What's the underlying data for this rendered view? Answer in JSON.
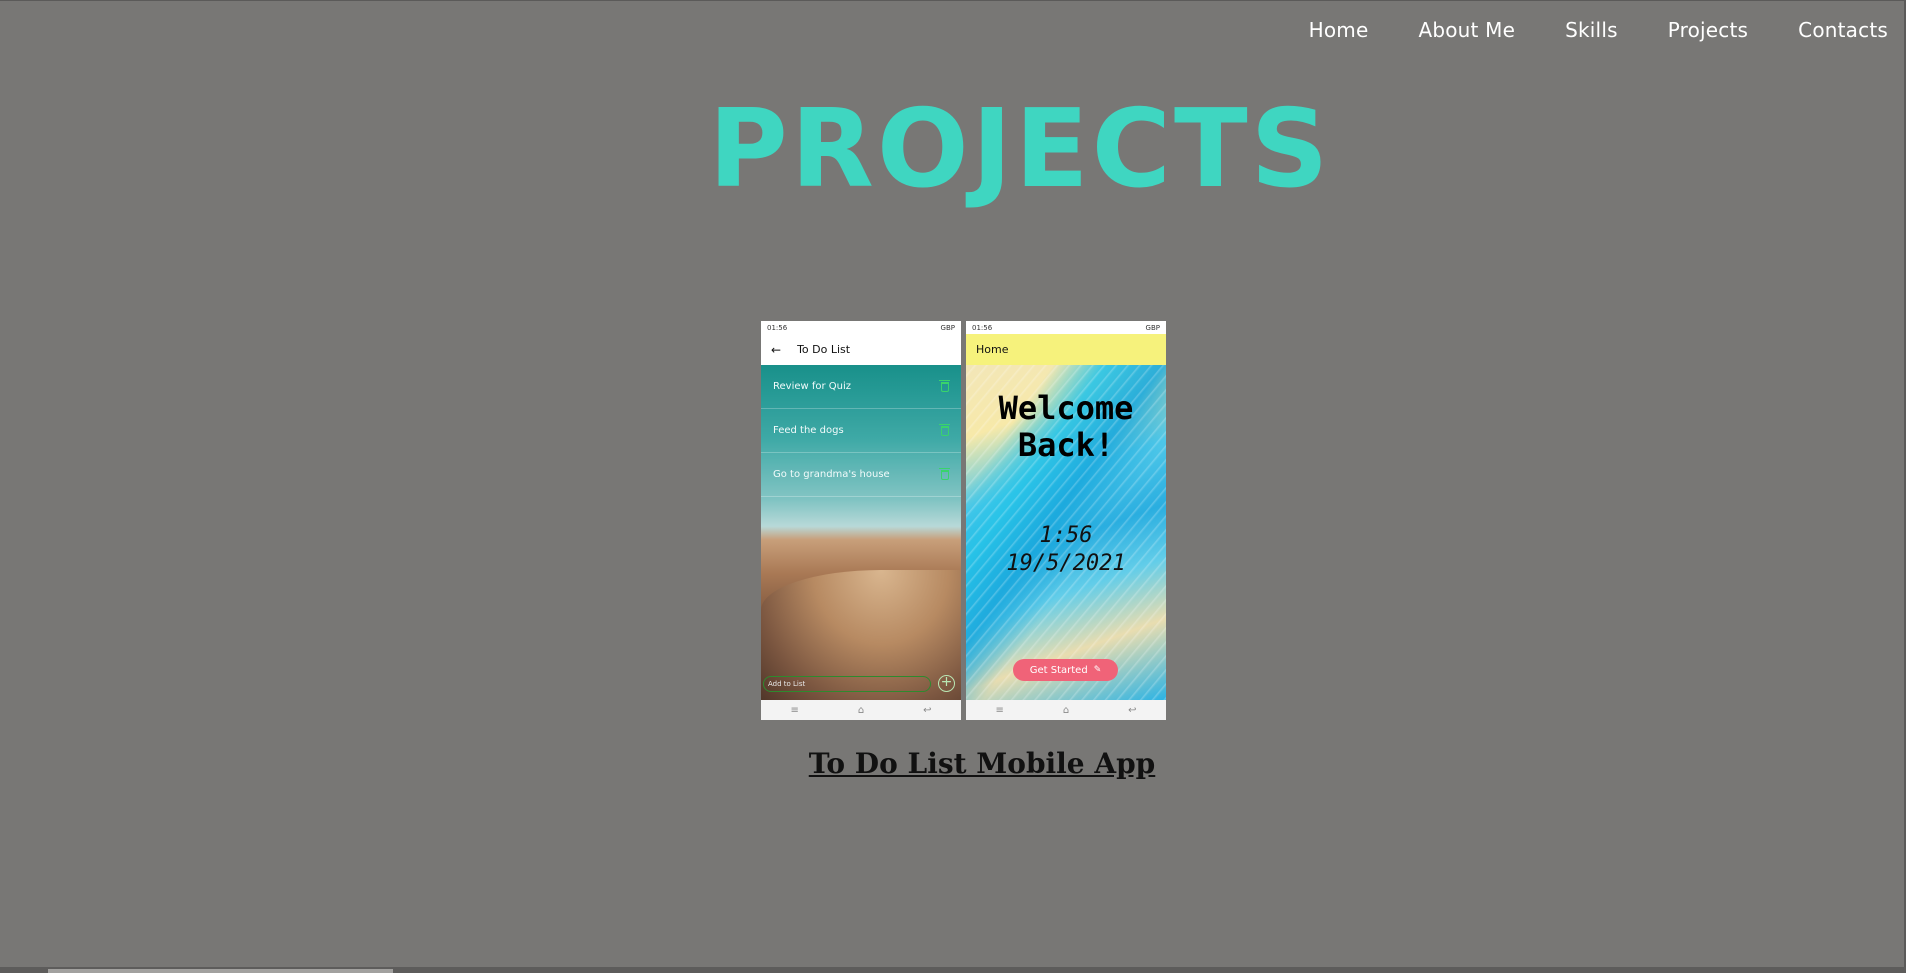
{
  "nav": {
    "items": [
      "Home",
      "About Me",
      "Skills",
      "Projects",
      "Contacts"
    ]
  },
  "page": {
    "title": "PROJECTS"
  },
  "project": {
    "title": "To Do List Mobile App",
    "screenshot1": {
      "status_time": "01:56",
      "status_dots": "···",
      "battery": "GBP",
      "appbar_title": "To Do List",
      "items": [
        "Review for Quiz",
        "Feed the dogs",
        "Go to grandma's house"
      ],
      "add_placeholder": "Add to List"
    },
    "screenshot2": {
      "status_time": "01:56",
      "status_dots": "···",
      "battery": "GBP",
      "appbar_title": "Home",
      "welcome_line1": "Welcome",
      "welcome_line2": "Back!",
      "time": "1:56",
      "date": "19/5/2021",
      "button_label": "Get Started"
    }
  },
  "colors": {
    "background": "#787775",
    "title": "#3fd6c1",
    "button": "#f06378",
    "appbar_yellow": "#f6f27c"
  }
}
